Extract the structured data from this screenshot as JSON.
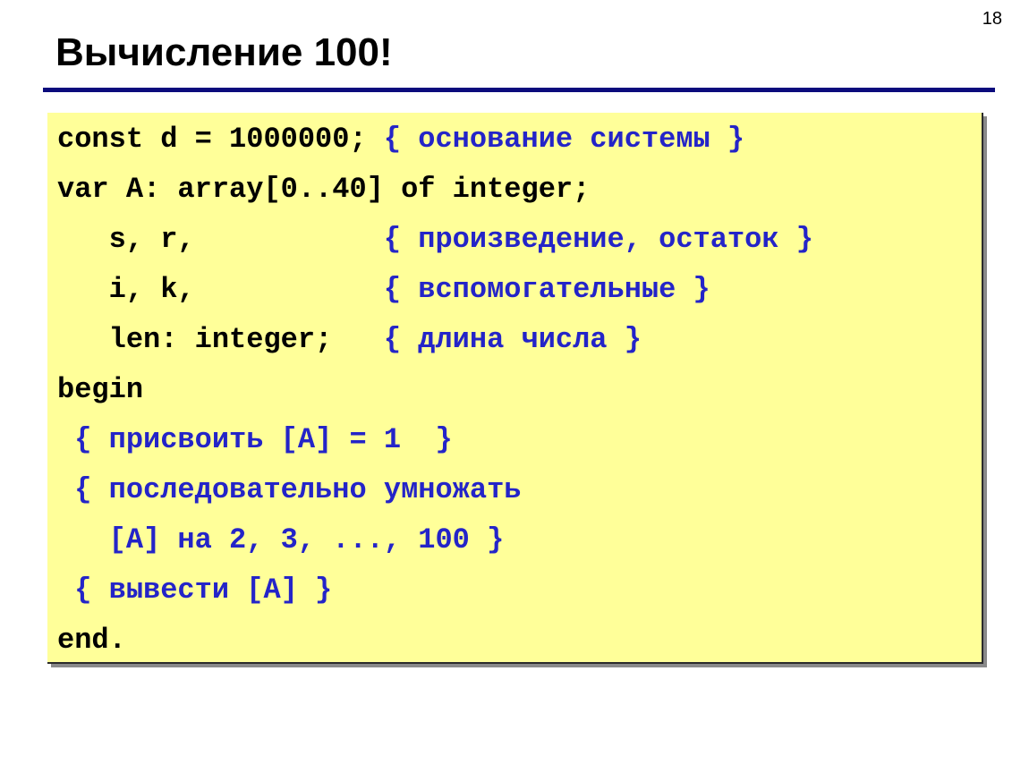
{
  "slide": {
    "page_number": "18",
    "title": "Вычисление 100!"
  },
  "code": {
    "lines": [
      {
        "code": "const d = 1000000; ",
        "comment": "{ основание системы }"
      },
      {
        "code": "var A: array[0..40] of integer;",
        "comment": ""
      },
      {
        "code": "   s, r,           ",
        "comment": "{ произведение, остаток }"
      },
      {
        "code": "   i, k,           ",
        "comment": "{ вспомогательные }"
      },
      {
        "code": "   len: integer;   ",
        "comment": "{ длина числа }"
      },
      {
        "code": "begin",
        "comment": ""
      },
      {
        "code": " ",
        "comment": "{ присвоить [A] = 1  }"
      },
      {
        "code": " ",
        "comment": "{ последовательно умножать"
      },
      {
        "code": "   ",
        "comment": "[A] на 2, 3, ..., 100 }"
      },
      {
        "code": " ",
        "comment": "{ вывести [A] }"
      },
      {
        "code": "end.",
        "comment": ""
      }
    ]
  },
  "colors": {
    "code_background": "#ffff99",
    "comment_text": "#2424c8",
    "title_rule": "#0b0b7c"
  }
}
